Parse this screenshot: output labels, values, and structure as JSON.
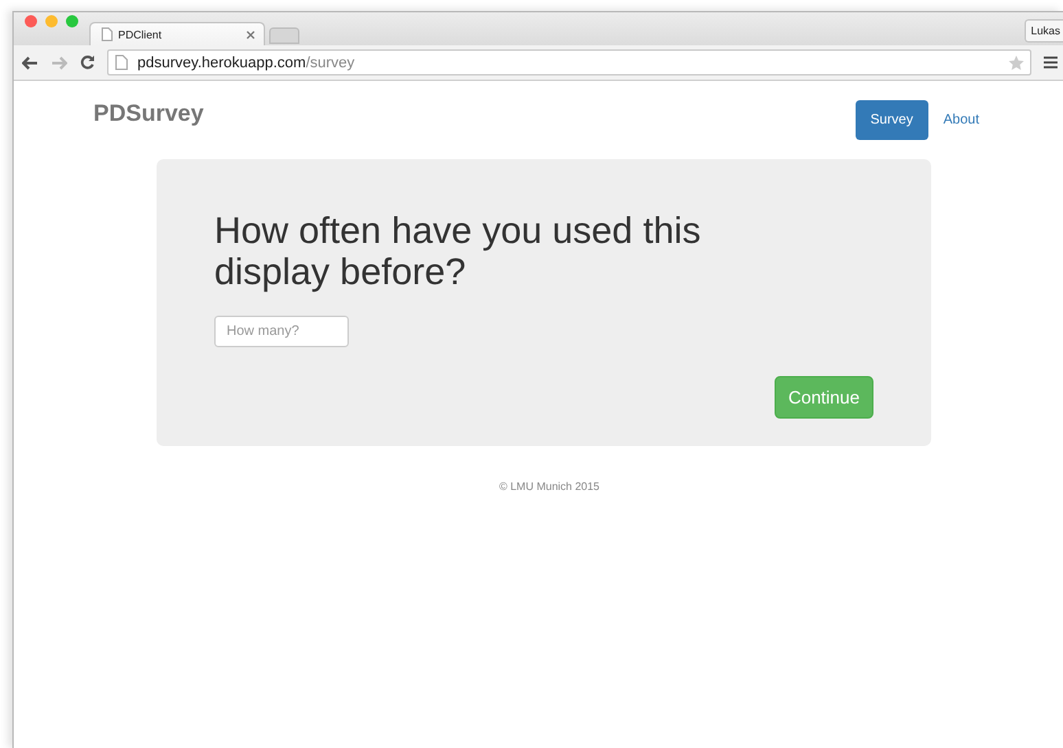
{
  "browser": {
    "tabs": [
      {
        "title": "PDClient",
        "selected": true
      }
    ],
    "profile": "Lukas",
    "url": {
      "host": "pdsurvey.herokuapp.com",
      "path": "/survey"
    }
  },
  "navbar": {
    "brand": "PDSurvey",
    "items": [
      {
        "label": "Survey",
        "selected": true
      },
      {
        "label": "About",
        "selected": false
      }
    ]
  },
  "question": {
    "title": "How often have you used this display before?",
    "field": {
      "placeholder": "How many?"
    },
    "button": "Continue"
  },
  "footer": "© LMU Munich 2015"
}
